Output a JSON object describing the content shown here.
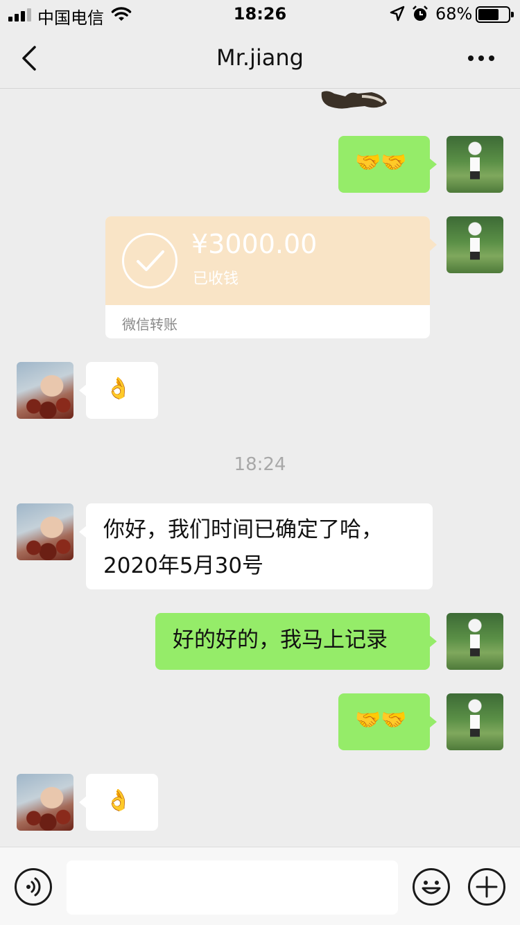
{
  "status_bar": {
    "carrier": "中国电信",
    "time": "18:26",
    "battery_percent": "68%",
    "battery_level": 0.68,
    "icons": [
      "signal-icon",
      "wifi-icon",
      "location-icon",
      "alarm-icon",
      "battery-icon"
    ]
  },
  "nav": {
    "back_icon": "chevron-left-icon",
    "title": "Mr.jiang",
    "more_icon": "more-dots-icon"
  },
  "messages": [
    {
      "type": "sticker-fragment",
      "from": "me"
    },
    {
      "type": "emoji",
      "from": "me",
      "text": "🤝🤝"
    },
    {
      "type": "transfer",
      "from": "me",
      "amount": "¥3000.00",
      "status": "已收钱",
      "label": "微信转账"
    },
    {
      "type": "emoji",
      "from": "other",
      "text": "👌"
    },
    {
      "type": "time",
      "text": "18:24"
    },
    {
      "type": "text",
      "from": "other",
      "lines": [
        "你好，我们时间已确定了哈，",
        "2020年5月30号"
      ]
    },
    {
      "type": "text",
      "from": "me",
      "text": "好的好的，我马上记录"
    },
    {
      "type": "emoji",
      "from": "me",
      "text": "🤝🤝"
    },
    {
      "type": "emoji",
      "from": "other",
      "text": "👌"
    }
  ],
  "input_bar": {
    "voice_icon": "voice-icon",
    "text_value": "",
    "emoji_icon": "emoji-face-icon",
    "plus_icon": "plus-icon"
  },
  "colors": {
    "background": "#ededed",
    "my_bubble": "#95ec69",
    "their_bubble": "#ffffff",
    "transfer_header": "#f9e4c6"
  }
}
